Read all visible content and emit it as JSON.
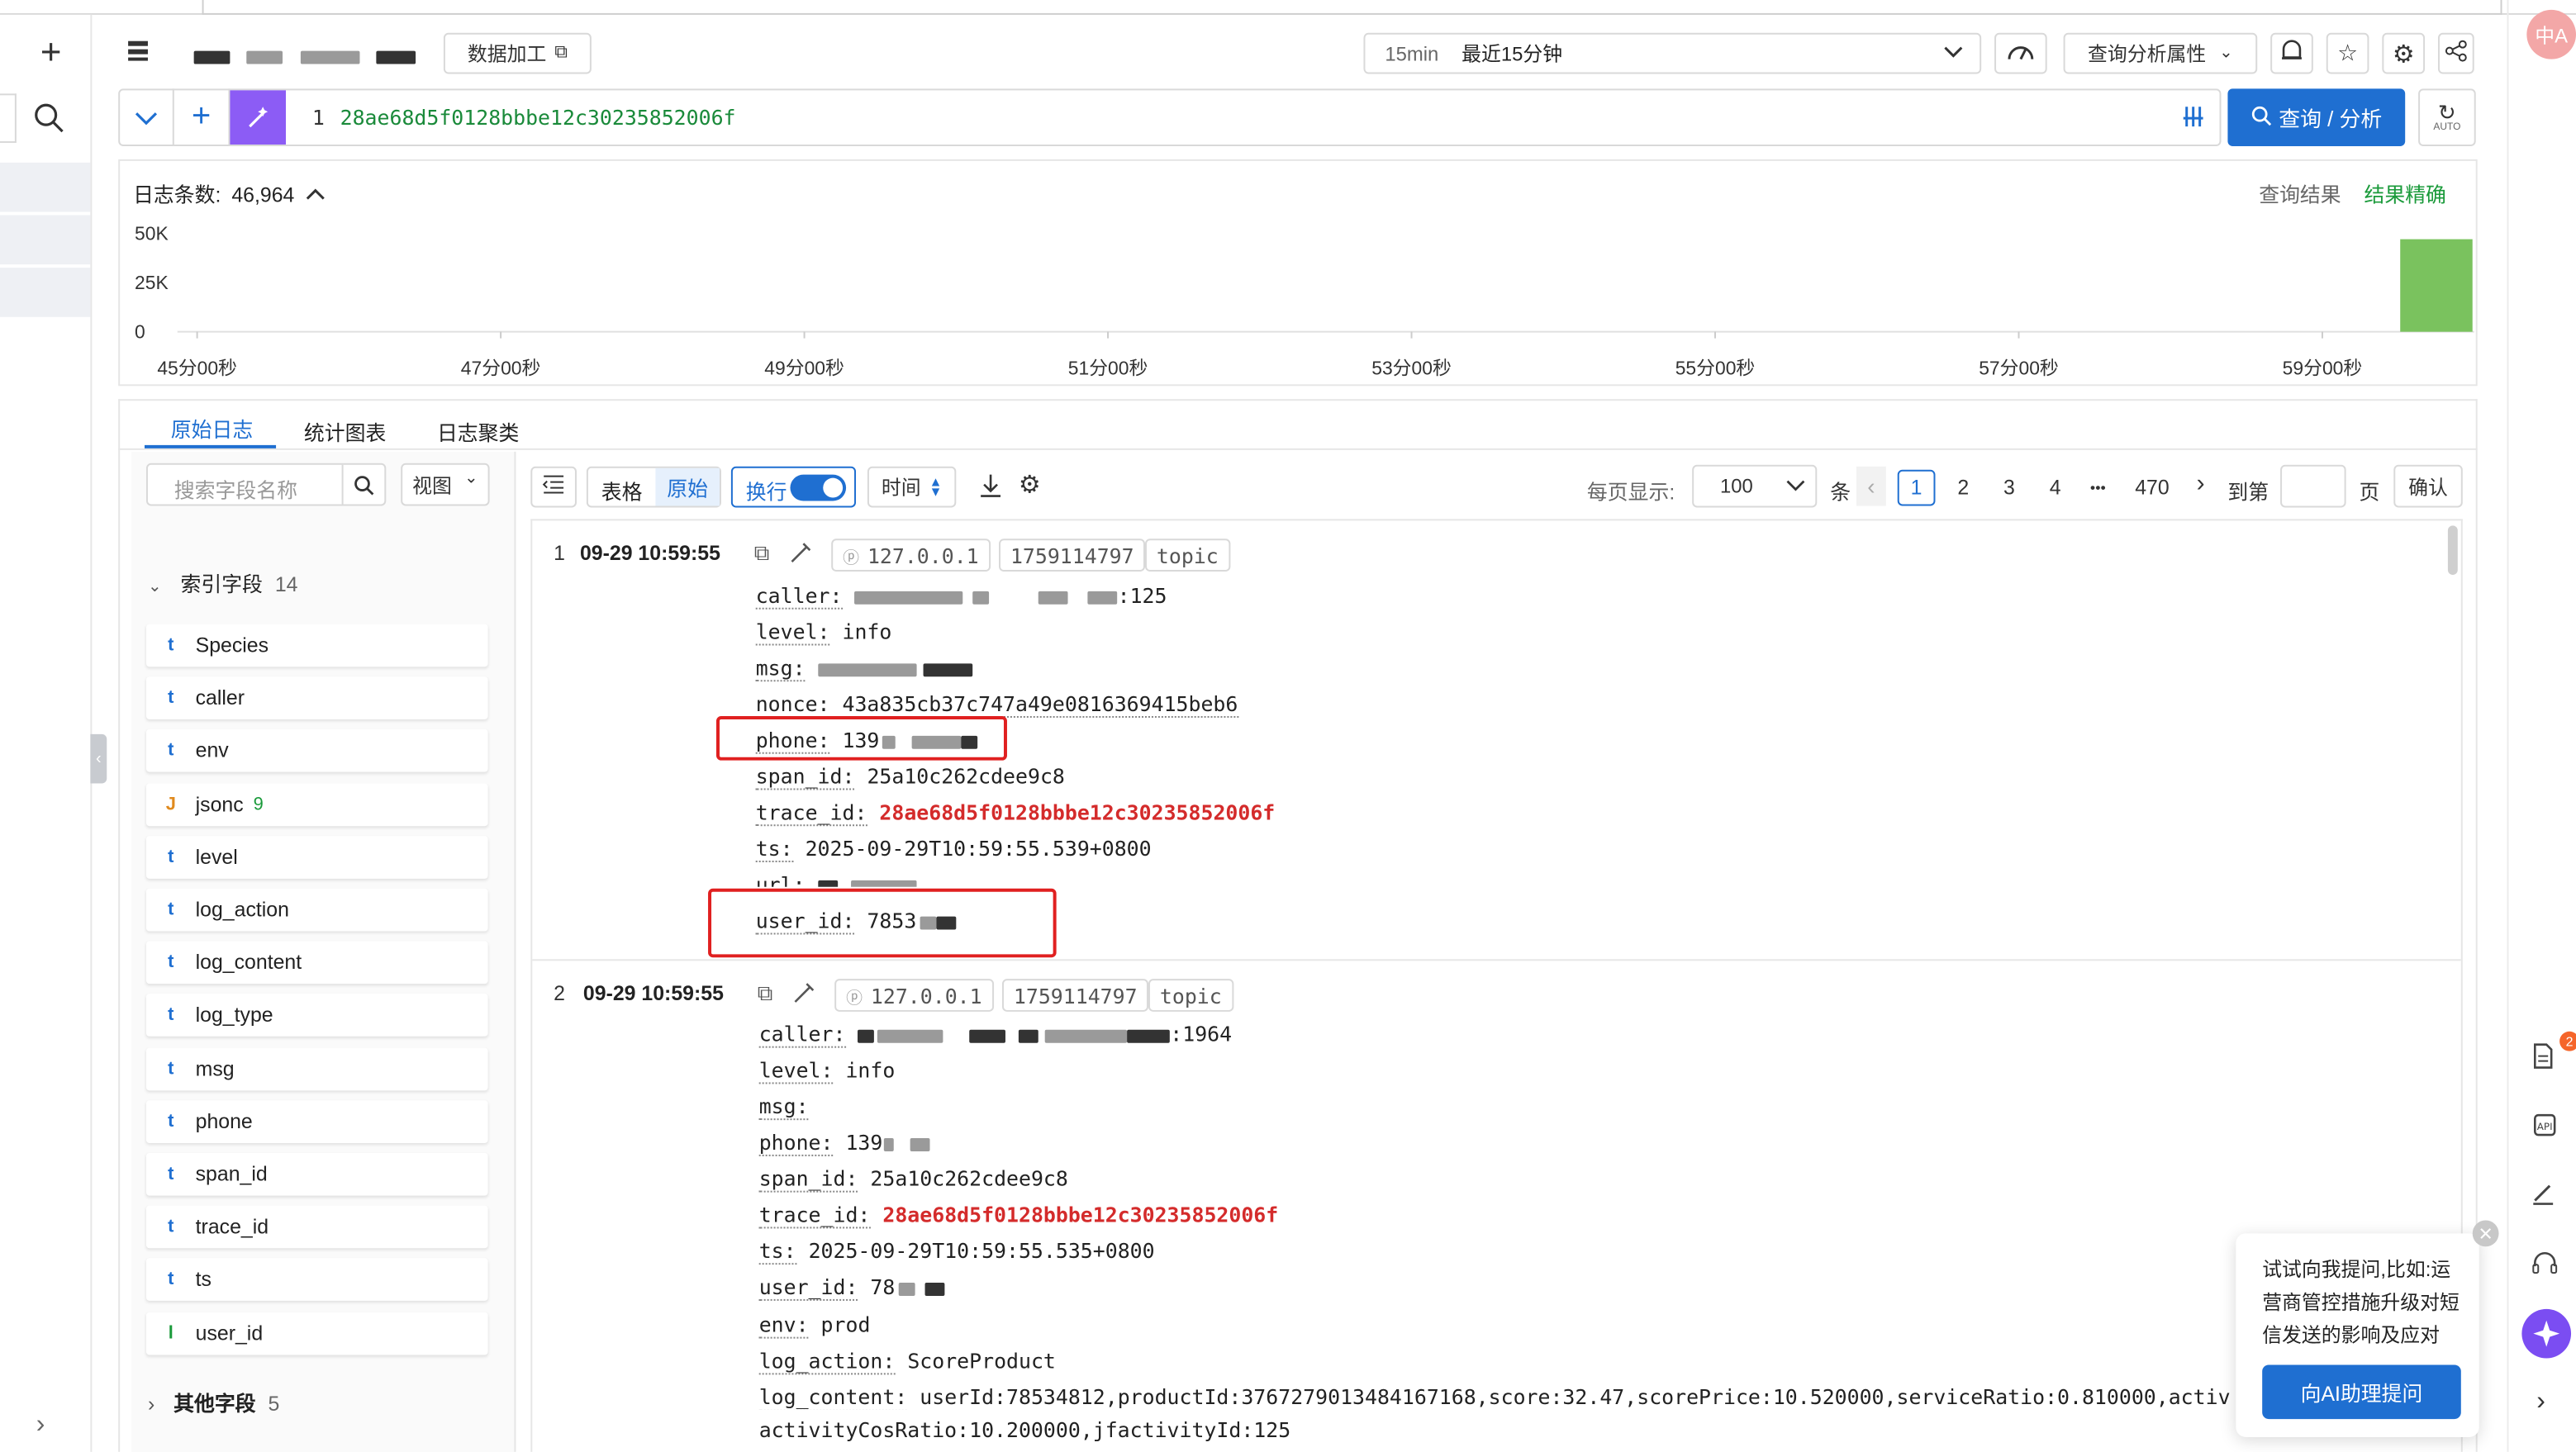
{
  "tabs_top": {
    "active_tab": ""
  },
  "topbar": {
    "data_process_label": "数据加工",
    "time_badge": "15min",
    "time_range": "最近15分钟",
    "query_attr_label": "查询分析属性"
  },
  "query": {
    "line_no": "1",
    "text": "28ae68d5f0128bbbe12c30235852006f",
    "search_button": "查询 / 分析",
    "auto_label": "AUTO"
  },
  "histogram": {
    "count_label": "日志条数:",
    "count_value": "46,964",
    "result_label": "查询结果",
    "result_status": "结果精确",
    "accent": "#7ac25e"
  },
  "chart_data": {
    "type": "bar",
    "y_ticks": [
      "50K",
      "25K",
      "0"
    ],
    "x_ticks": [
      "45分00秒",
      "47分00秒",
      "49分00秒",
      "51分00秒",
      "53分00秒",
      "55分00秒",
      "57分00秒",
      "59分00秒"
    ],
    "ylim": [
      0,
      50000
    ],
    "series": [
      {
        "values": [
          46964
        ]
      }
    ]
  },
  "subtabs": [
    "原始日志",
    "统计图表",
    "日志聚类"
  ],
  "fields_panel": {
    "search_placeholder": "搜索字段名称",
    "view_label": "视图",
    "indexed_label": "索引字段",
    "indexed_count": "14",
    "other_label": "其他字段",
    "other_count": "5",
    "fields": [
      {
        "type": "t",
        "name": "Species"
      },
      {
        "type": "t",
        "name": "caller"
      },
      {
        "type": "t",
        "name": "env"
      },
      {
        "type": "J",
        "name": "jsonc",
        "count": "9"
      },
      {
        "type": "t",
        "name": "level"
      },
      {
        "type": "t",
        "name": "log_action"
      },
      {
        "type": "t",
        "name": "log_content"
      },
      {
        "type": "t",
        "name": "log_type"
      },
      {
        "type": "t",
        "name": "msg"
      },
      {
        "type": "t",
        "name": "phone"
      },
      {
        "type": "t",
        "name": "span_id"
      },
      {
        "type": "t",
        "name": "trace_id"
      },
      {
        "type": "t",
        "name": "ts"
      },
      {
        "type": "l",
        "name": "user_id"
      }
    ]
  },
  "toolbar": {
    "table_label": "表格",
    "raw_label": "原始",
    "wrap_label": "换行",
    "time_label": "时间",
    "per_page_label": "每页显示:",
    "per_page_value": "100",
    "unit_label": "条",
    "pages": [
      "1",
      "2",
      "3",
      "4",
      "•••",
      "470"
    ],
    "goto_label": "到第",
    "page_unit": "页",
    "confirm_label": "确认"
  },
  "logs": [
    {
      "index": "1",
      "time": "09-29 10:59:55",
      "ip": "127.0.0.1",
      "epoch": "1759114797",
      "topic": "topic",
      "caller_value": ":125",
      "level_value": "info",
      "nonce_value": "43a835cb37c747a49e0816369415beb6",
      "phone_value": "139",
      "span_value": "25a10c262cdee9c8",
      "trace_value": "28ae68d5f0128bbbe12c30235852006f",
      "ts_value": "2025-09-29T10:59:55.539+0800",
      "user_value": "7853"
    },
    {
      "index": "2",
      "time": "09-29 10:59:55",
      "ip": "127.0.0.1",
      "epoch": "1759114797",
      "topic": "topic",
      "caller_value": ":1964",
      "level_value": "info",
      "phone_value": "139",
      "span_value": "25a10c262cdee9c8",
      "trace_value": "28ae68d5f0128bbbe12c30235852006f",
      "ts_value": "2025-09-29T10:59:55.535+0800",
      "user_value": "78",
      "env_value": "prod",
      "log_action_value": "ScoreProduct",
      "log_content_value": "userId:78534812,productId:3767279013484167168,score:32.47,scorePrice:10.520000,serviceRatio:0.810000,activityPr",
      "log_content_line2": "activityCosRatio:10.200000,jfactivityId:125"
    }
  ],
  "keys": {
    "caller": "caller:",
    "level": "level:",
    "msg": "msg:",
    "nonce": "nonce:",
    "phone": "phone:",
    "span": "span_id:",
    "trace": "trace_id:",
    "ts": "ts:",
    "url": "url:",
    "user": "user_id:",
    "env": "env:",
    "log_action": "log_action:",
    "log_content": "log_content:"
  },
  "ai_popup": {
    "text": "试试向我提问,比如:运营商管控措施升级对短信发送的影响及应对",
    "button": "向AI助理提问"
  },
  "avatar_text": "中A",
  "rail_badge": "2"
}
